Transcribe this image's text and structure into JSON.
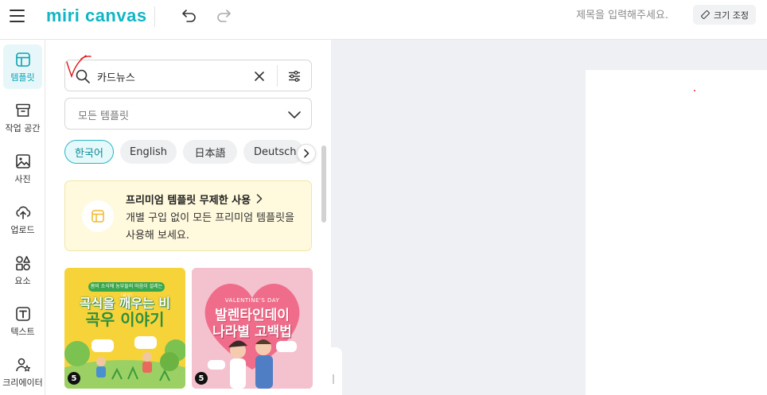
{
  "header": {
    "logo": "miri canvas",
    "title_placeholder": "제목을 입력해주세요.",
    "resize_label": "크기 조정"
  },
  "sidebar": {
    "items": [
      {
        "label": "템플릿",
        "icon": "template-icon"
      },
      {
        "label": "작업 공간",
        "icon": "archive-icon"
      },
      {
        "label": "사진",
        "icon": "photo-icon"
      },
      {
        "label": "업로드",
        "icon": "upload-cloud-icon"
      },
      {
        "label": "요소",
        "icon": "shapes-icon"
      },
      {
        "label": "텍스트",
        "icon": "text-icon"
      },
      {
        "label": "크리에이터",
        "icon": "creator-icon"
      }
    ]
  },
  "panel": {
    "search_value": "카드뉴스",
    "dropdown_value": "모든 템플릿",
    "chips": [
      "한국어",
      "English",
      "日本語",
      "Deutsch"
    ],
    "promo": {
      "title": "프리미엄 템플릿 무제한 사용",
      "description": "개별 구입 없이 모든 프리미엄 템플릿을 사용해 보세요."
    },
    "cards": [
      {
        "subtitle": "봄비 소식에 농부들의 마음이 설레는 '곡우'",
        "title_line1": "곡식을 깨우는 비",
        "title_line2": "곡우 이야기",
        "pages": "5"
      },
      {
        "subtitle": "VALENTINE'S DAY",
        "title_line1": "발렌타인데이",
        "title_line2": "나라별 고백법",
        "pages": "5"
      }
    ]
  },
  "colors": {
    "accent": "#12b5c5",
    "promo_bg": "#fff9dd"
  }
}
